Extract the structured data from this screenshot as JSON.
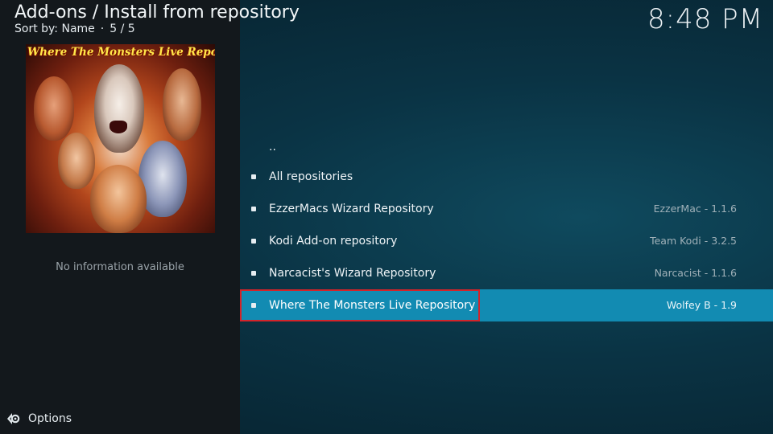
{
  "header": {
    "title": "Add-ons / Install from repository",
    "sort_label": "Sort by: Name",
    "separator": "·",
    "position": "5 / 5"
  },
  "clock": "8:48 PM",
  "artwork": {
    "banner_text": "Where The Monsters Live Repo"
  },
  "info_panel": {
    "text": "No information available"
  },
  "options": {
    "icon": "options-gear-icon",
    "label": "Options"
  },
  "list": {
    "items": [
      {
        "label": "..",
        "meta": "",
        "bullet": false
      },
      {
        "label": "All repositories",
        "meta": "",
        "bullet": true
      },
      {
        "label": "EzzerMacs Wizard Repository",
        "meta": "EzzerMac - 1.1.6",
        "bullet": true
      },
      {
        "label": "Kodi Add-on repository",
        "meta": "Team Kodi - 3.2.5",
        "bullet": true
      },
      {
        "label": "Narcacist's Wizard Repository",
        "meta": "Narcacist - 1.1.6",
        "bullet": true
      },
      {
        "label": "Where The Monsters Live Repository",
        "meta": "Wolfey B - 1.9",
        "bullet": true,
        "selected": true
      }
    ]
  },
  "colors": {
    "selection": "#128bb2",
    "highlight_border": "#d3242a",
    "left_panel": "#13181c"
  }
}
